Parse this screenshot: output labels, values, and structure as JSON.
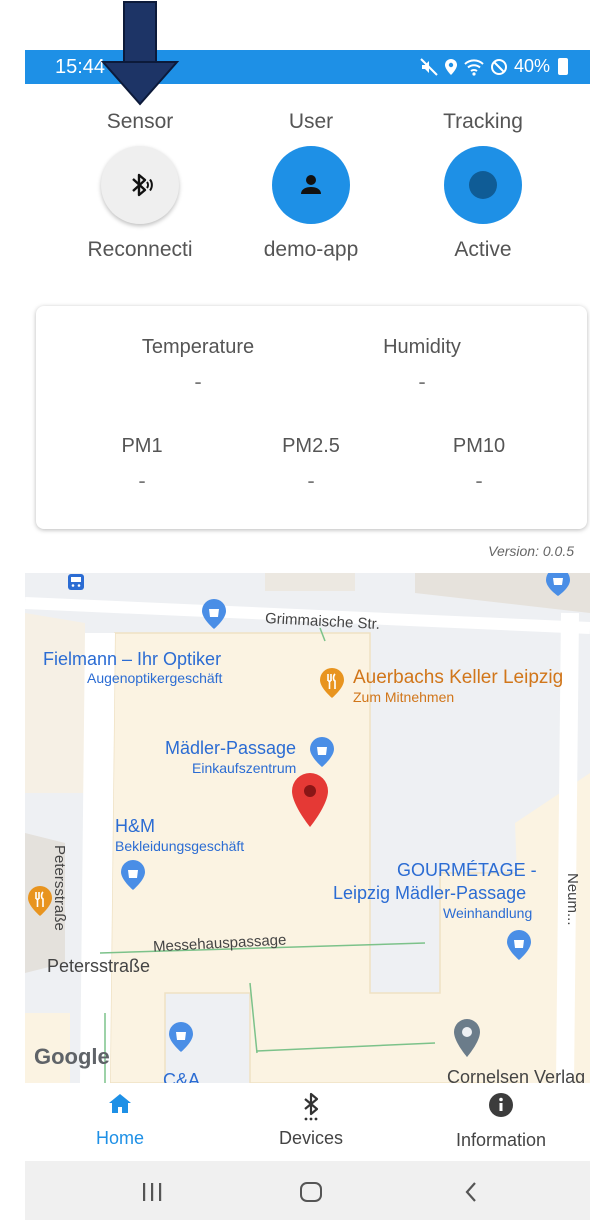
{
  "status_bar": {
    "time": "15:44",
    "battery": "40%"
  },
  "status_row": {
    "sensor": {
      "title": "Sensor",
      "caption": "Reconnecti",
      "icon": "bluetooth-searching-icon"
    },
    "user": {
      "title": "User",
      "caption": "demo-app",
      "icon": "person-icon"
    },
    "tracking": {
      "title": "Tracking",
      "caption": "Active",
      "icon": "tracking-dot-icon"
    }
  },
  "readings": {
    "temperature": {
      "label": "Temperature",
      "value": "-"
    },
    "humidity": {
      "label": "Humidity",
      "value": "-"
    },
    "pm1": {
      "label": "PM1",
      "value": "-"
    },
    "pm25": {
      "label": "PM2.5",
      "value": "-"
    },
    "pm10": {
      "label": "PM10",
      "value": "-"
    }
  },
  "version": "Version: 0.0.5",
  "map": {
    "streets": {
      "grimmaische": "Grimmaische Str.",
      "petersstrasse_vertical": "Petersstraße",
      "messehauspassage": "Messehauspassage",
      "petersstrasse": "Petersstraße",
      "neumarkt": "Neum..."
    },
    "places": {
      "fielmann": {
        "name": "Fielmann – Ihr Optiker",
        "type": "Augenoptikergeschäft"
      },
      "auerbachs": {
        "name": "Auerbachs Keller Leipzig",
        "type": "Zum Mitnehmen"
      },
      "maedler": {
        "name": "Mädler-Passage",
        "type": "Einkaufszentrum"
      },
      "hm": {
        "name": "H&M",
        "type": "Bekleidungsgeschäft"
      },
      "gourmetage": {
        "name_line1": "GOURMÉTAGE -",
        "name_line2": "Leipzig Mädler-Passage",
        "type": "Weinhandlung"
      },
      "ca": {
        "name": "C&A"
      },
      "cornelsen": {
        "name": "Cornelsen Verlag"
      }
    },
    "google_logo": "Google",
    "colors": {
      "blue_poi": "#2b6cd3",
      "orange_poi": "#d1761a",
      "marker": "#e53935"
    }
  },
  "bottom_nav": {
    "home": {
      "label": "Home",
      "icon": "home-icon",
      "active": true
    },
    "devices": {
      "label": "Devices",
      "icon": "bluetooth-icon"
    },
    "information": {
      "label": "Information",
      "icon": "info-icon"
    }
  },
  "colors": {
    "accent": "#1e90e6",
    "status_bar": "#1e90e6"
  }
}
